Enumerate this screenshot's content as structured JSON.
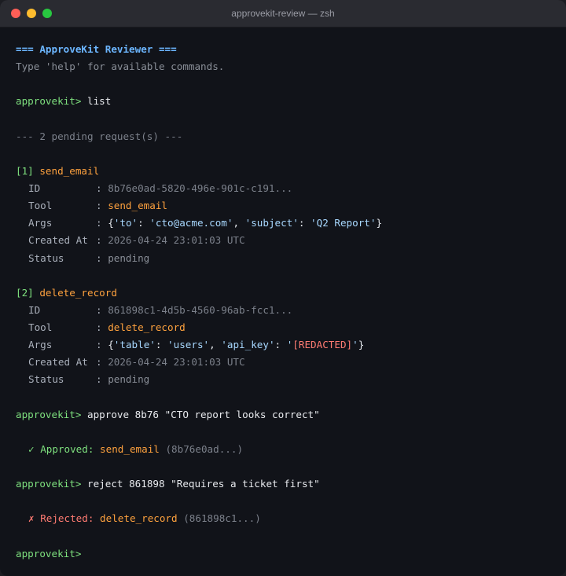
{
  "window": {
    "title": "approvekit-review — zsh",
    "colors": {
      "close": "#ff5f57",
      "minimize": "#febc2e",
      "maximize": "#28c840",
      "background": "#111319"
    }
  },
  "terminal": {
    "prompt": "approvekit>",
    "header": "=== ApproveKit Reviewer ===",
    "hint": "Type 'help' for available commands.",
    "cmd_list": "list",
    "pending_summary": "--- 2 pending request(s) ---",
    "labels": {
      "id": "ID",
      "tool": "Tool",
      "args": "Args",
      "created_at": "Created At",
      "status": "Status",
      "colon": ":"
    },
    "requests": [
      {
        "index": "[1]",
        "name": "send_email",
        "id": "8b76e0ad-5820-496e-901c-c191...",
        "tool": "send_email",
        "args": {
          "open": "{",
          "k1": "'to'",
          "sep1": ": ",
          "v1": "'cto@acme.com'",
          "comma": ", ",
          "k2": "'subject'",
          "sep2": ": ",
          "v2": "'Q2 Report'",
          "close": "}"
        },
        "created_at": "2026-04-24 23:01:03 UTC",
        "status": "pending"
      },
      {
        "index": "[2]",
        "name": "delete_record",
        "id": "861898c1-4d5b-4560-96ab-fcc1...",
        "tool": "delete_record",
        "args": {
          "open": "{",
          "k1": "'table'",
          "sep1": ": ",
          "v1": "'users'",
          "comma": ", ",
          "k2": "'api_key'",
          "sep2": ": ",
          "q_open": "'",
          "redacted": "[REDACTED]",
          "q_close": "'",
          "close": "}"
        },
        "created_at": "2026-04-24 23:01:03 UTC",
        "status": "pending"
      }
    ],
    "cmd_approve": "approve 8b76 \"CTO report looks correct\"",
    "approved": {
      "mark": "✓",
      "label": "Approved:",
      "tool": "send_email",
      "ref": "(8b76e0ad...)"
    },
    "cmd_reject": "reject 861898 \"Requires a ticket first\"",
    "rejected": {
      "mark": "✗",
      "label": "Rejected:",
      "tool": "delete_record",
      "ref": "(861898c1...)"
    }
  }
}
